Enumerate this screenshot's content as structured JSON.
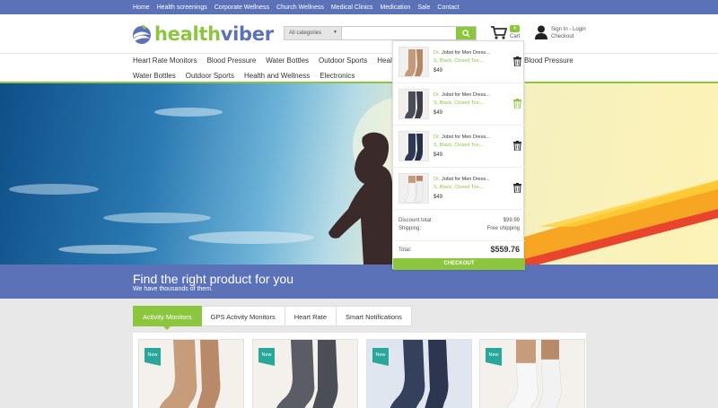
{
  "topnav": {
    "links": [
      "Home",
      "Health screenings",
      "Corporate Wellness",
      "Church Wellness",
      "Medical Clinics",
      "Medication",
      "Sale",
      "Contact"
    ]
  },
  "header": {
    "logo_a": "health",
    "logo_b": "viber",
    "search_category": "All categories",
    "search_placeholder": "",
    "cart_count": "4",
    "cart_label": "Cart",
    "sign_in": "Sign In - Login",
    "checkout": "Checkout"
  },
  "categories": {
    "row1": [
      "Heart Rate Monitors",
      "Blood Pressure",
      "Water Bottles",
      "Outdoor Sports",
      "Health a"
    ],
    "row1_tail": "Blood Pressure",
    "row2": [
      "Water Bottles",
      "Outdoor Sports",
      "Health and Wellness",
      "Electronics"
    ]
  },
  "banner": {
    "title": "Find the right product for you",
    "subtitle": "We have thousands of them."
  },
  "tabs": [
    "Activity Monitors",
    "GPS Activity Monitors",
    "Heart Rate",
    "Smart Notifications"
  ],
  "products": [
    {
      "badge": "New"
    },
    {
      "badge": "New"
    },
    {
      "badge": "New"
    },
    {
      "badge": "New"
    }
  ],
  "cart_dropdown": {
    "items": [
      {
        "brand": "Dr.",
        "name": "Jobst for Men Dress...",
        "variant": "S, Black, Closed Toe,...",
        "price": "$49",
        "sock_color": "#c49a78"
      },
      {
        "brand": "Dr.",
        "name": "Jobst for Men Dress...",
        "variant": "S, Black, Closed Toe,...",
        "price": "$49",
        "sock_color": "#4a4d57"
      },
      {
        "brand": "Dr.",
        "name": "Jobst for Men Dress...",
        "variant": "S, Black, Closed Toe,...",
        "price": "$49",
        "sock_color": "#2e3a55"
      },
      {
        "brand": "Dr.",
        "name": "Jobst for Men Dress...",
        "variant": "S, Black, Closed Toe,...",
        "price": "$49",
        "sock_color": "#f2f2f2"
      }
    ],
    "discount_label": "Discount total:",
    "discount_value": "$99.99",
    "shipping_label": "Shipping:",
    "shipping_value": "Free shipping",
    "total_label": "Total:",
    "total_value": "$559.76",
    "checkout_label": "CHECKOUT"
  },
  "colors": {
    "brand_blue": "#5b72b8",
    "brand_green": "#8cc63f",
    "badge_teal": "#2aa79b"
  }
}
